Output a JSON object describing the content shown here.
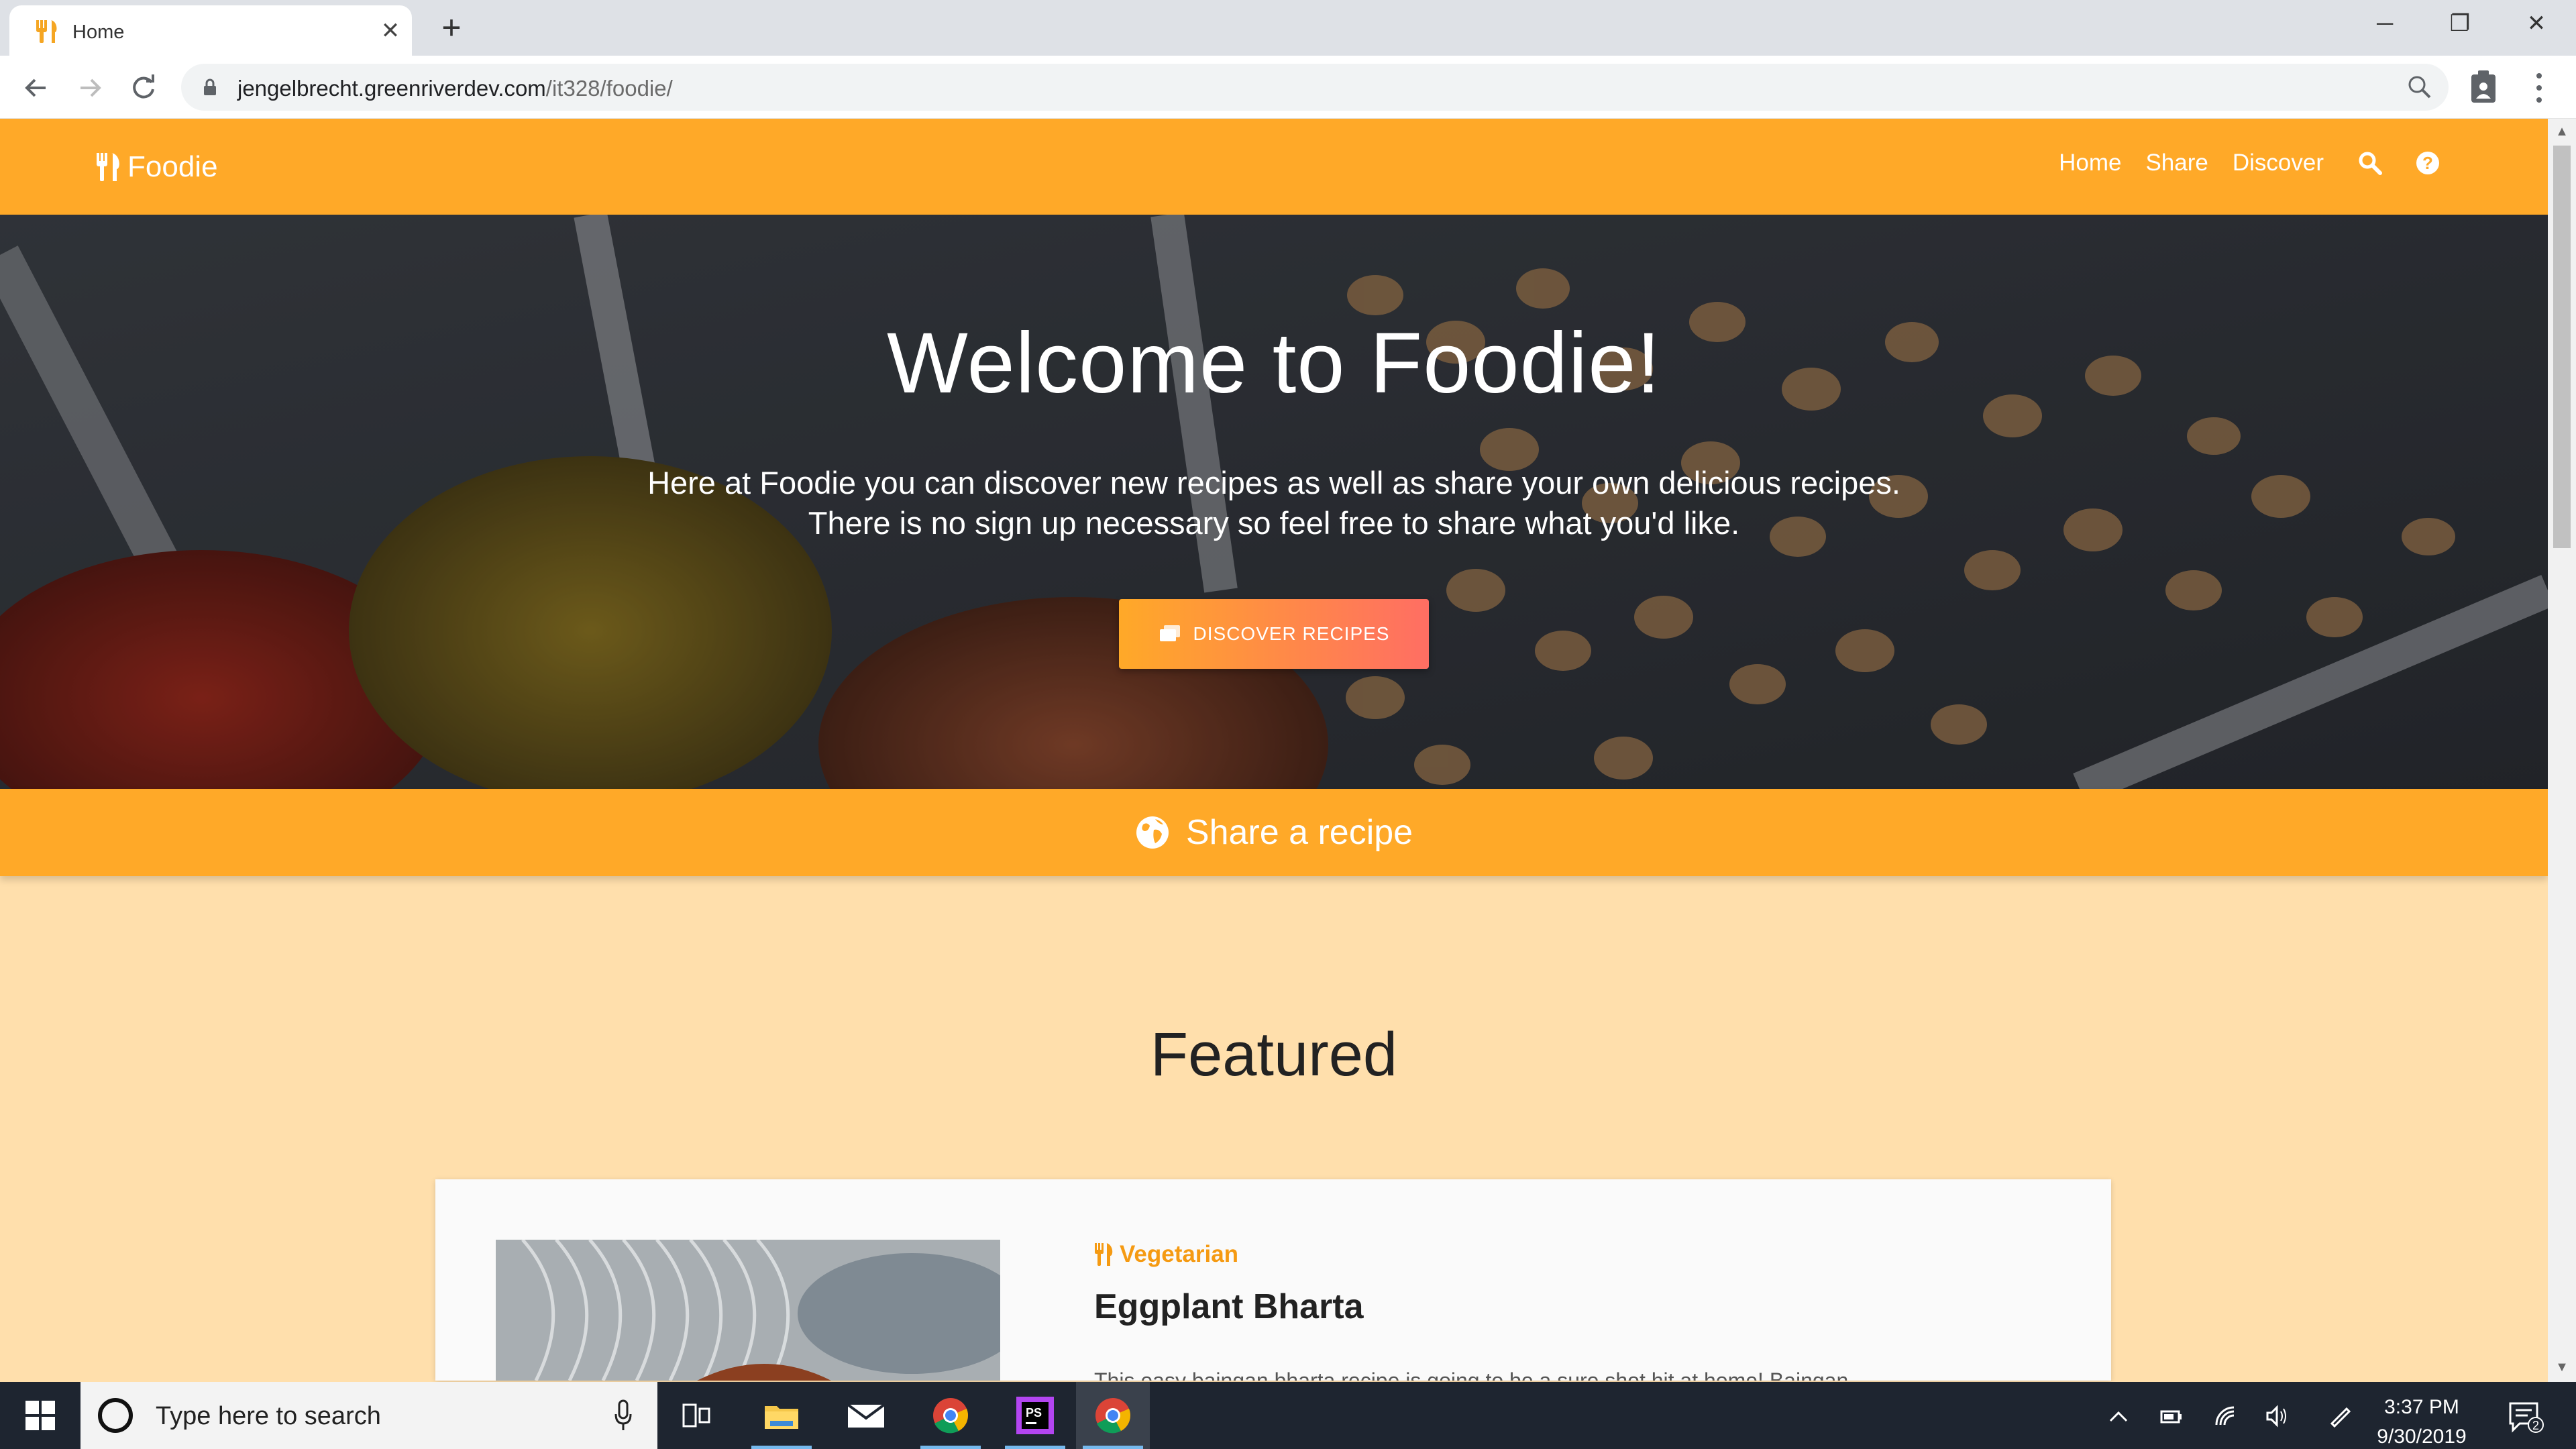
{
  "browser": {
    "tab_title": "Home",
    "url_host": "jengelbrecht.greenriverdev.com",
    "url_path": "/it328/foodie/"
  },
  "navbar": {
    "brand": "Foodie",
    "links": [
      "Home",
      "Share",
      "Discover"
    ]
  },
  "hero": {
    "title": "Welcome to Foodie!",
    "line1": "Here at Foodie you can discover new recipes as well as share your own delicious recipes.",
    "line2": "There is no sign up necessary so feel free to share what you'd like.",
    "button": "DISCOVER RECIPES"
  },
  "share_bar": {
    "label": "Share a recipe"
  },
  "featured": {
    "heading": "Featured",
    "card": {
      "category": "Vegetarian",
      "title": "Eggplant Bharta",
      "description": "This easy baingan bharta recipe is going to be a sure shot hit at home! Baingan"
    }
  },
  "taskbar": {
    "search_placeholder": "Type here to search",
    "time": "3:37 PM",
    "date": "9/30/2019",
    "notification_count": "2"
  },
  "colors": {
    "brand_orange": "#ffa928",
    "page_bg": "#ffdfac",
    "button_gradient_end": "#ff6e63",
    "category_orange": "#f59a12"
  }
}
